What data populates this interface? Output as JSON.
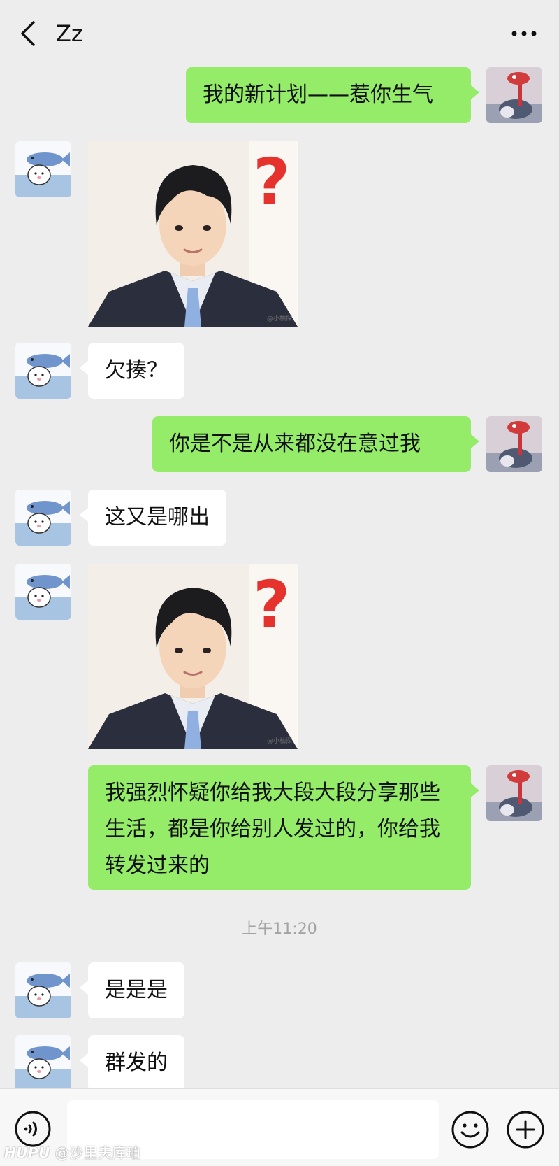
{
  "header": {
    "title": "Zz",
    "back_icon": "chevron-left-icon",
    "more_icon": "more-dots-icon"
  },
  "messages": [
    {
      "sender": "self",
      "type": "text",
      "text": "我的新计划——惹你生气"
    },
    {
      "sender": "other",
      "type": "image",
      "image": "sticker-boy-question-mark",
      "caption": "@小柚探"
    },
    {
      "sender": "other",
      "type": "text",
      "text": "欠揍？"
    },
    {
      "sender": "self",
      "type": "text",
      "text": "你是不是从来都没在意过我"
    },
    {
      "sender": "other",
      "type": "text",
      "text": "这又是哪出"
    },
    {
      "sender": "other",
      "type": "image",
      "image": "sticker-boy-question-mark",
      "caption": "@小柚探"
    },
    {
      "sender": "self",
      "type": "text",
      "text": "我强烈怀疑你给我大段大段分享那些生活，都是你给别人发过的，你给我转发过来的"
    },
    {
      "sender": "other",
      "type": "text",
      "text": "是是是"
    },
    {
      "sender": "other",
      "type": "text",
      "text": "群发的"
    }
  ],
  "timestamp": "上午11:20",
  "input_bar": {
    "voice_icon": "voice-icon",
    "input_value": "",
    "emoji_icon": "emoji-icon",
    "plus_icon": "plus-icon"
  },
  "watermark": {
    "brand": "HUPU",
    "user": "@沙里夫库珀"
  },
  "colors": {
    "background": "#ededed",
    "self_bubble": "#95ec69",
    "other_bubble": "#ffffff"
  }
}
